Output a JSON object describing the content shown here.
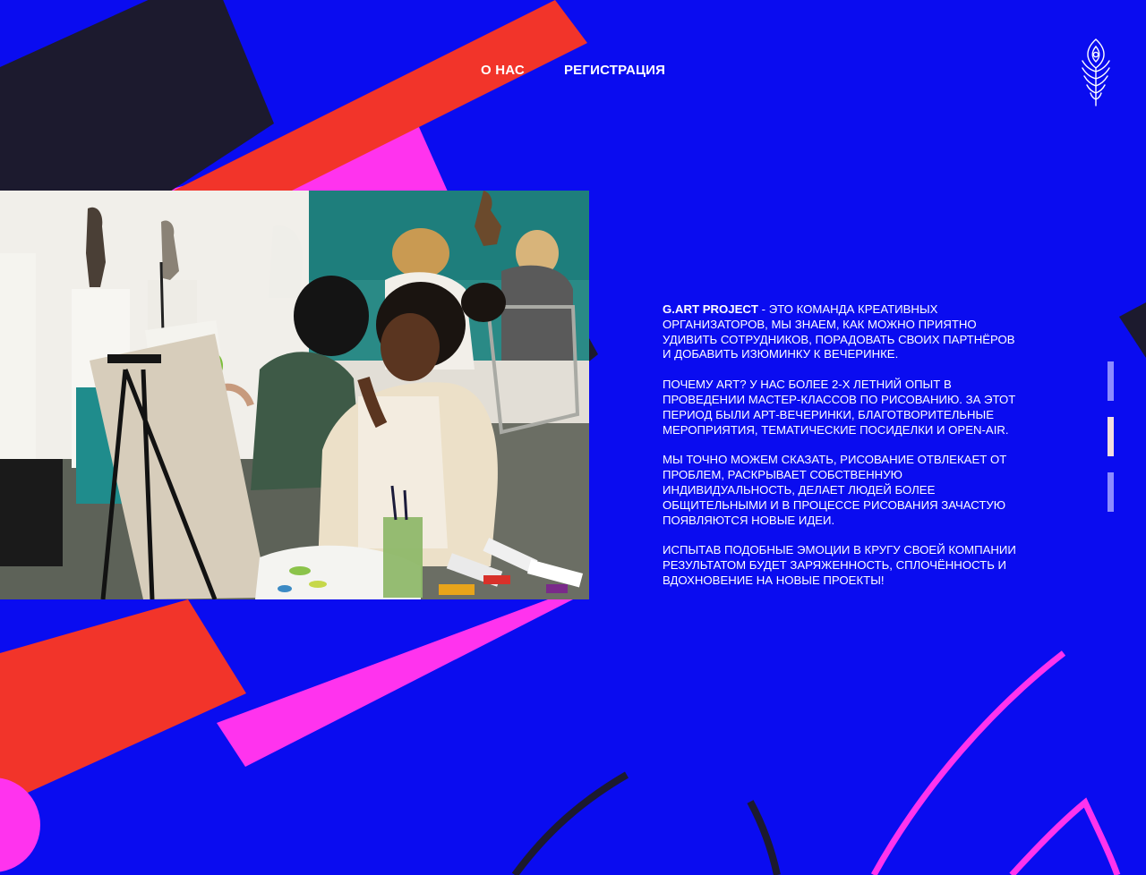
{
  "nav": {
    "about": "О НАС",
    "register": "РЕГИСТРАЦИЯ"
  },
  "logo": {
    "icon": "peacock-feather-icon"
  },
  "about": {
    "brand": "G.ART PROJECT",
    "p1_rest": " - ЭТО КОМАНДА КРЕАТИВНЫХ ОРГАНИЗАТОРОВ, МЫ ЗНАЕМ, КАК МОЖНО ПРИЯТНО УДИВИТЬ СОТРУДНИКОВ, ПОРАДОВАТЬ СВОИХ ПАРТНЁРОВ И ДОБАВИТЬ ИЗЮМИНКУ К ВЕЧЕРИНКЕ.",
    "p2": "ПОЧЕМУ ART? У НАС БОЛЕЕ 2-Х ЛЕТНИЙ ОПЫТ В ПРОВЕДЕНИИ МАСТЕР-КЛАССОВ ПО РИСОВАНИЮ. ЗА ЭТОТ ПЕРИОД БЫЛИ АРТ-ВЕЧЕРИНКИ, БЛАГОТВОРИТЕЛЬНЫЕ МЕРОПРИЯТИЯ, ТЕМАТИЧЕСКИЕ ПОСИДЕЛКИ И OPEN-AIR.",
    "p3": "МЫ ТОЧНО МОЖЕМ СКАЗАТЬ, РИСОВАНИЕ ОТВЛЕКАЕТ ОТ ПРОБЛЕМ, РАСКРЫВАЕТ СОБСТВЕННУЮ ИНДИВИДУАЛЬНОСТЬ, ДЕЛАЕТ ЛЮДЕЙ БОЛЕЕ ОБЩИТЕЛЬНЫМИ И В ПРОЦЕССЕ РИСОВАНИЯ ЗАЧАСТУЮ ПОЯВЛЯЮТСЯ НОВЫЕ ИДЕИ.",
    "p4": "ИСПЫТАВ ПОДОБНЫЕ ЭМОЦИИ В КРУГУ СВОЕЙ КОМПАНИИ РЕЗУЛЬТАТОМ БУДЕТ ЗАРЯЖЕННОСТЬ, СПЛОЧЁННОСТЬ И ВДОХНОВЕНИЕ НА НОВЫЕ ПРОЕКТЫ!"
  },
  "pager": {
    "count": 3,
    "active_index": 1
  },
  "colors": {
    "background": "#0a0cf0",
    "red": "#f2342a",
    "pink": "#ff33ee",
    "dark": "#1c1a2e",
    "text": "#ffffff",
    "pager_inactive": "#8c8cff",
    "pager_active": "#f3dede"
  }
}
